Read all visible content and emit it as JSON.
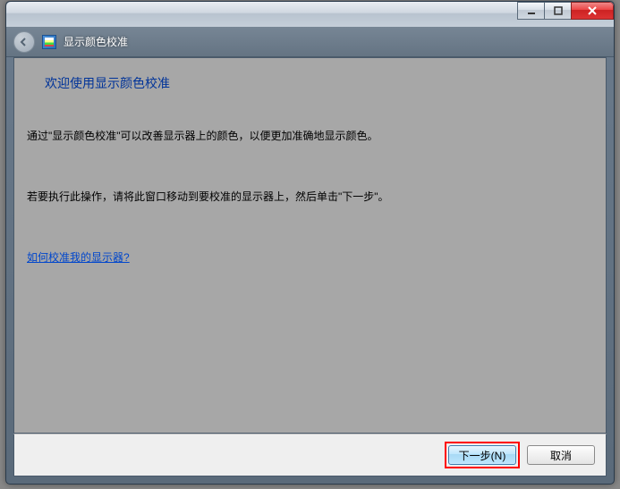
{
  "window": {
    "app_title": "显示颜色校准"
  },
  "content": {
    "heading": "欢迎使用显示颜色校准",
    "paragraph1": "通过\"显示颜色校准\"可以改善显示器上的颜色，以便更加准确地显示颜色。",
    "paragraph2": "若要执行此操作，请将此窗口移动到要校准的显示器上，然后单击\"下一步\"。",
    "help_link": "如何校准我的显示器?"
  },
  "footer": {
    "next_label": "下一步(N)",
    "cancel_label": "取消"
  }
}
